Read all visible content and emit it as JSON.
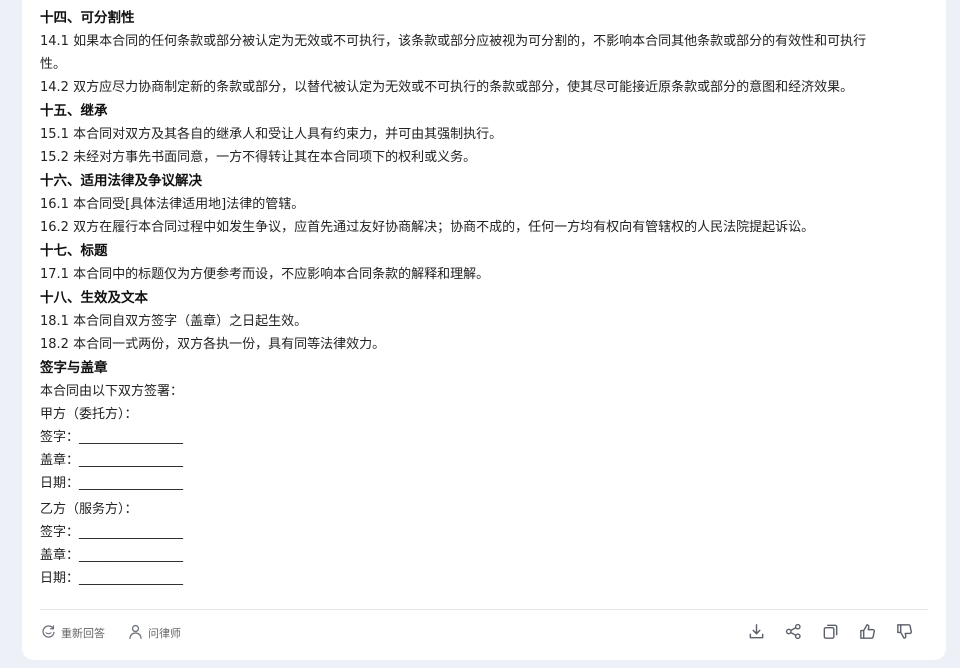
{
  "sections": [
    {
      "heading": "十四、可分割性",
      "paragraphs": [
        "14.1 如果本合同的任何条款或部分被认定为无效或不可执行，该条款或部分应被视为可分割的，不影响本合同其他条款或部分的有效性和可执行",
        "性。",
        "14.2 双方应尽力协商制定新的条款或部分，以替代被认定为无效或不可执行的条款或部分，使其尽可能接近原条款或部分的意图和经济效果。"
      ]
    },
    {
      "heading": "十五、继承",
      "paragraphs": [
        "15.1 本合同对双方及其各自的继承人和受让人具有约束力，并可由其强制执行。",
        "15.2 未经对方事先书面同意，一方不得转让其在本合同项下的权利或义务。"
      ]
    },
    {
      "heading": "十六、适用法律及争议解决",
      "paragraphs": [
        "16.1 本合同受[具体法律适用地]法律的管辖。",
        "16.2 双方在履行本合同过程中如发生争议，应首先通过友好协商解决；协商不成的，任何一方均有权向有管辖权的人民法院提起诉讼。"
      ]
    },
    {
      "heading": "十七、标题",
      "paragraphs": [
        "17.1 本合同中的标题仅为方便参考而设，不应影响本合同条款的解释和理解。"
      ]
    },
    {
      "heading": "十八、生效及文本",
      "paragraphs": [
        "18.1 本合同自双方签字（盖章）之日起生效。",
        "18.2 本合同一式两份，双方各执一份，具有同等法律效力。"
      ]
    }
  ],
  "signature": {
    "heading": "签字与盖章",
    "intro": "本合同由以下双方签署：",
    "party_a": {
      "title": "甲方（委托方）：",
      "sign": "签字：________________",
      "seal": "盖章：________________",
      "date": "日期：________________"
    },
    "party_b": {
      "title": "乙方（服务方）：",
      "sign": "签字：________________",
      "seal": "盖章：________________",
      "date": "日期：________________"
    }
  },
  "footer": {
    "regenerate_label": "重新回答",
    "lawyer_label": "问律师",
    "icons": [
      "download-icon",
      "share-icon",
      "copy-icon",
      "thumbs-up-icon",
      "thumbs-down-icon"
    ]
  }
}
